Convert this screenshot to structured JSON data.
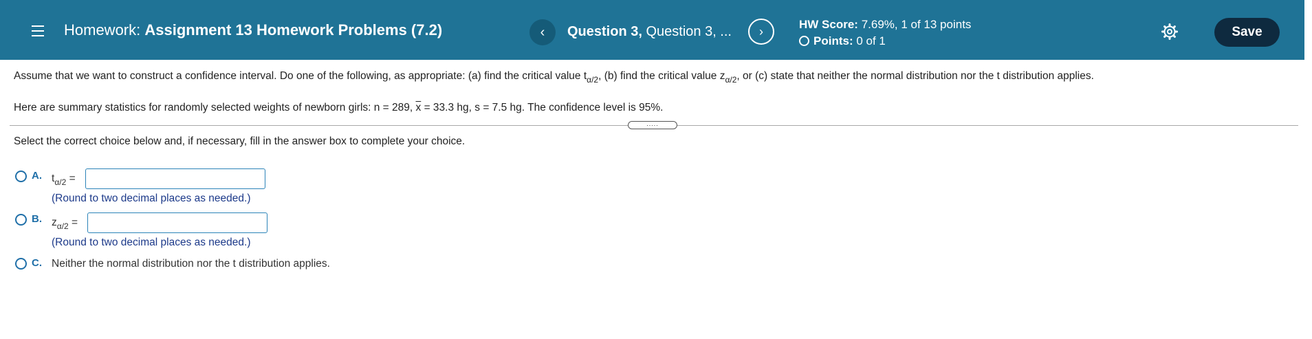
{
  "header": {
    "title_prefix": "Homework:",
    "title": "Assignment 13 Homework Problems (7.2)",
    "question_bold": "Question 3,",
    "question_rest": " Question 3, ...",
    "score_label": "HW Score:",
    "score_value": " 7.69%, 1 of 13 points",
    "points_label": "Points:",
    "points_value": " 0 of 1",
    "save_label": "Save",
    "brand_color": "#1f7396"
  },
  "question": {
    "line1_a": "Assume that we want to construct a confidence interval. Do one of the following, as appropriate: (a) find the critical value t",
    "line1_sub1": "α/2",
    "line1_b": ", (b) find the critical value z",
    "line1_sub2": "α/2",
    "line1_c": ", or (c) state that neither the normal distribution nor the t distribution applies.",
    "line2_a": "Here are summary statistics for randomly selected weights of newborn girls: n = 289, ",
    "line2_x": "x",
    "line2_b": " = 33.3 hg, s = 7.5 hg. The confidence level is 95%.",
    "grip_dots": ".....",
    "instruction": "Select the correct choice below and, if necessary, fill in the answer box to complete your choice."
  },
  "options": [
    {
      "letter": "A.",
      "var": "t",
      "sub": "α/2",
      "eq": " =",
      "value": "",
      "hint": "(Round to two decimal places as needed.)"
    },
    {
      "letter": "B.",
      "var": "z",
      "sub": "α/2",
      "eq": " =",
      "value": "",
      "hint": "(Round to two decimal places as needed.)"
    },
    {
      "letter": "C.",
      "text": "Neither the normal distribution nor the t distribution applies."
    }
  ]
}
